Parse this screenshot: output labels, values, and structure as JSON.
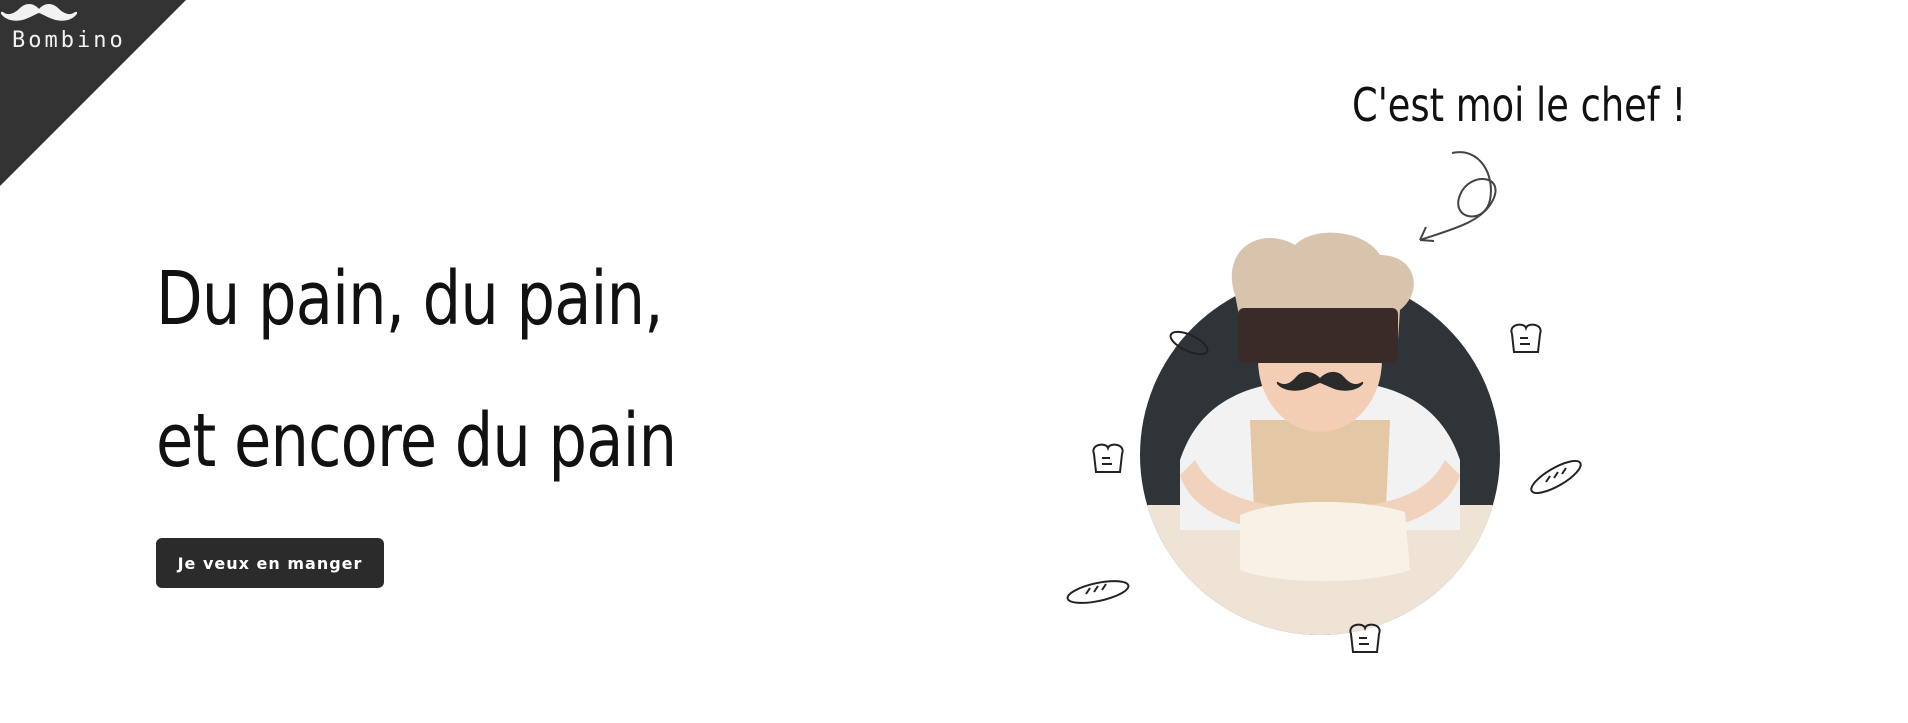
{
  "brand": {
    "name": "Bombino",
    "logo_icon": "mustache-icon",
    "corner_color": "#333333"
  },
  "hero": {
    "headline_line1": "Du pain, du pain,",
    "headline_line2": "et encore du pain",
    "cta_label": "Je veux en manger"
  },
  "illustration": {
    "caption": "C'est moi le chef !",
    "subject": "child-chef-photo",
    "decorations": [
      "baguette-icon",
      "bread-slice-icon",
      "curly-arrow-icon"
    ]
  },
  "colors": {
    "dark": "#2b2b2b",
    "background": "#ffffff",
    "photo_backdrop": "#2e3438"
  }
}
